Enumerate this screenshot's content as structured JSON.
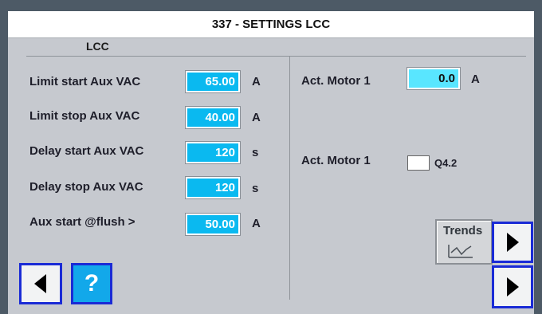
{
  "window": {
    "title": "337 - SETTINGS LCC"
  },
  "section": {
    "label": "LCC"
  },
  "left_rows": [
    {
      "label": "Limit start Aux VAC",
      "value": "65.00",
      "unit": "A"
    },
    {
      "label": "Limit stop Aux VAC",
      "value": "40.00",
      "unit": "A"
    },
    {
      "label": "Delay start Aux VAC",
      "value": "120",
      "unit": "s"
    },
    {
      "label": "Delay stop Aux VAC",
      "value": "120",
      "unit": "s"
    },
    {
      "label": "Aux start @flush >",
      "value": "50.00",
      "unit": "A"
    }
  ],
  "right": {
    "motor_current": {
      "label": "Act. Motor 1",
      "value": "0.0",
      "unit": "A"
    },
    "motor_status": {
      "label": "Act. Motor 1",
      "indicator_label": "Q4.2",
      "state": "off"
    }
  },
  "buttons": {
    "trends_label": "Trends",
    "help_label": "?",
    "back_icon": "triangle-left-icon",
    "next_icon": "triangle-right-icon"
  },
  "colors": {
    "field": "#0ab9f0",
    "field_active": "#59e6ff",
    "nav_border": "#1a2bd6",
    "panel": "#c6c9cf"
  }
}
